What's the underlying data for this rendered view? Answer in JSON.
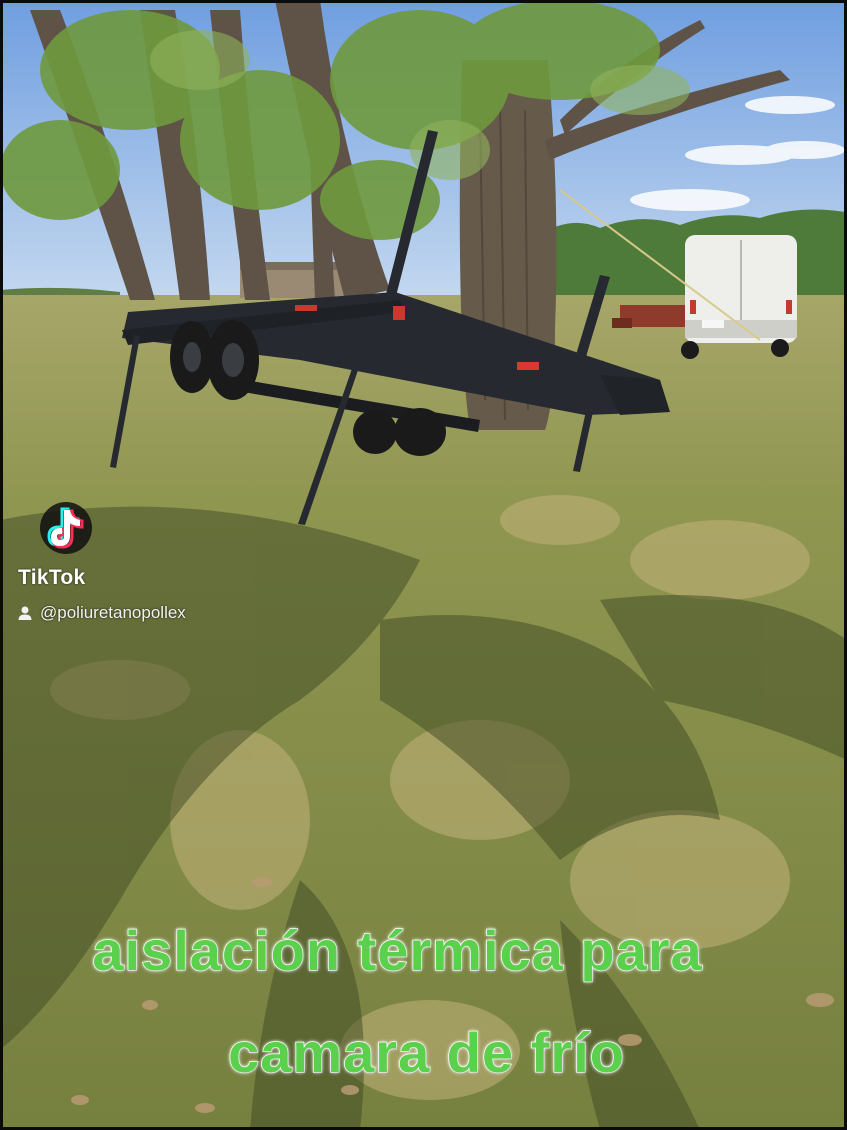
{
  "watermark": {
    "brand": "TikTok",
    "handle": "@poliuretanopollex",
    "logo_icon": "tiktok-note-icon",
    "user_icon": "user-icon"
  },
  "caption": {
    "line1": "aislación térmica para",
    "line2": "camara de frío",
    "color": "#5bd04d",
    "outline_color": "#ffffff"
  },
  "colors": {
    "sky": "#8fb8e6",
    "grass": "#7f8a45",
    "trailer": "#26292f",
    "van": "#eeeeea"
  }
}
